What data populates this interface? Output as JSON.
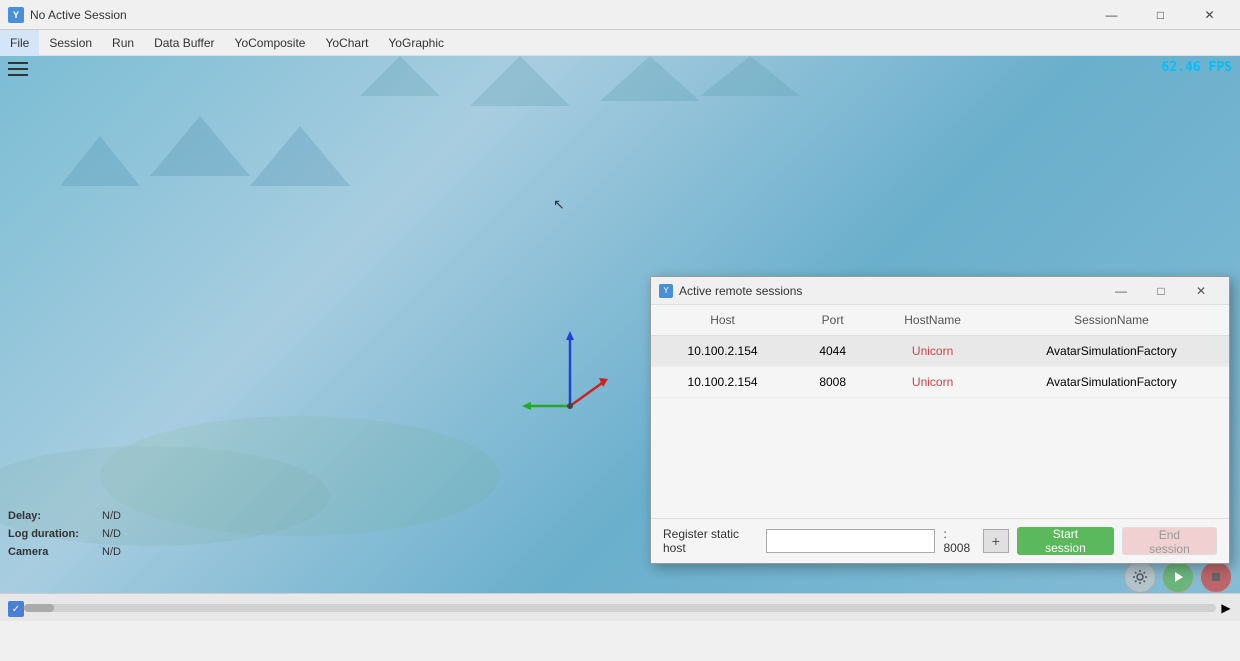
{
  "titlebar": {
    "icon_label": "Y",
    "title": "No Active Session",
    "minimize_label": "—",
    "maximize_label": "□",
    "close_label": "✕"
  },
  "menubar": {
    "items": [
      {
        "label": "File",
        "active": true
      },
      {
        "label": "Session",
        "active": false
      },
      {
        "label": "Run",
        "active": false
      },
      {
        "label": "Data Buffer",
        "active": false
      },
      {
        "label": "YoComposite",
        "active": false
      },
      {
        "label": "YoChart",
        "active": false
      },
      {
        "label": "YoGraphic",
        "active": false
      }
    ]
  },
  "viewport": {
    "fps": "62.46 FPS"
  },
  "status": {
    "delay_label": "Delay:",
    "delay_value": "N/D",
    "log_label": "Log duration:",
    "log_value": "N/D",
    "camera_label": "Camera",
    "camera_value": "N/D"
  },
  "modal": {
    "title": "Active remote sessions",
    "minimize_label": "—",
    "maximize_label": "□",
    "close_label": "✕",
    "columns": [
      "Host",
      "Port",
      "HostName",
      "SessionName"
    ],
    "rows": [
      {
        "host": "10.100.2.154",
        "port": "4044",
        "hostname": "Unicorn",
        "session": "AvatarSimulationFactory",
        "selected": true
      },
      {
        "host": "10.100.2.154",
        "port": "8008",
        "hostname": "Unicorn",
        "session": "AvatarSimulationFactory",
        "selected": false
      }
    ],
    "footer": {
      "label": "Register static host",
      "input_placeholder": "",
      "port_sep": ": 8008",
      "start_button": "Start session",
      "end_button": "End session"
    }
  }
}
